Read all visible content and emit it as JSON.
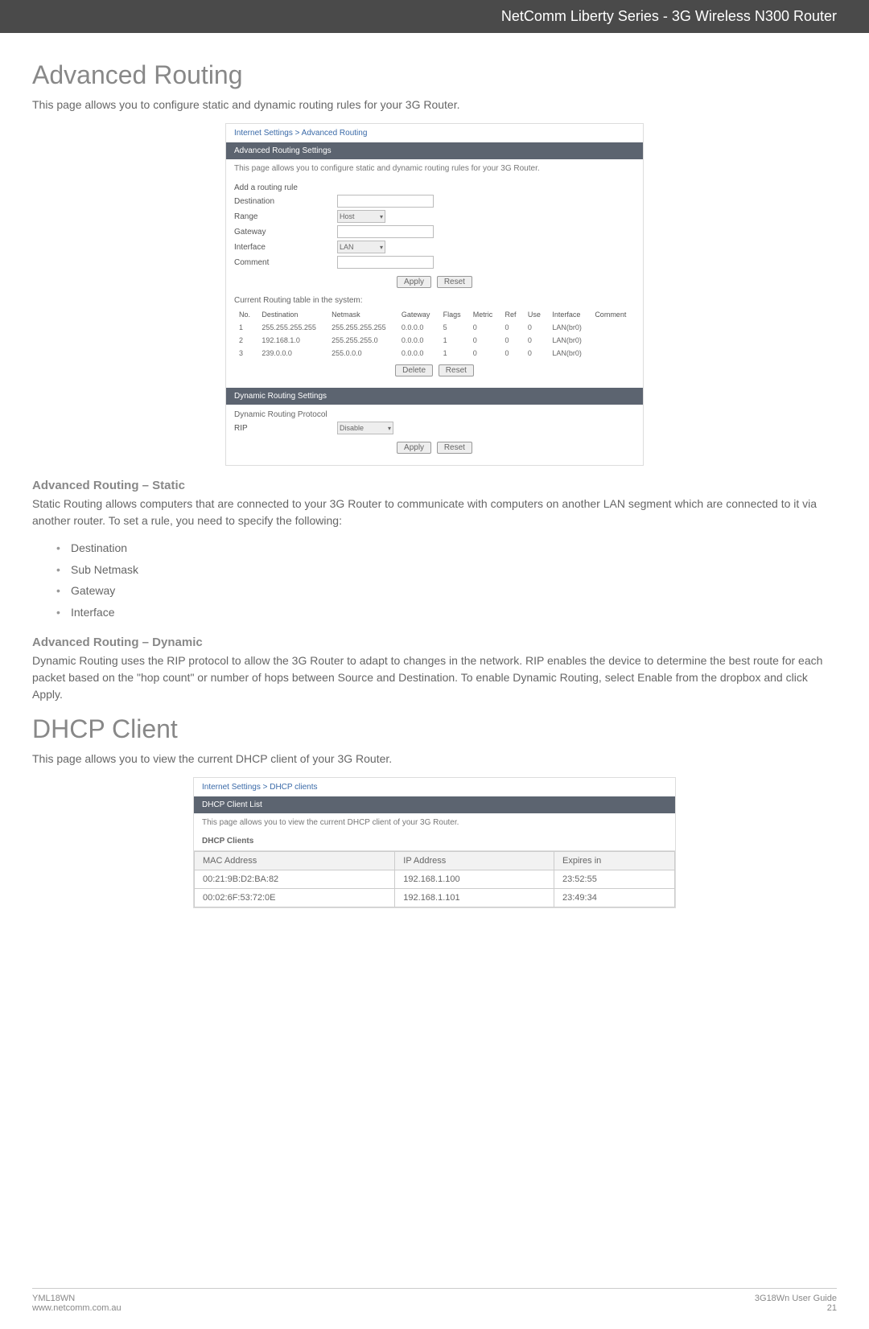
{
  "header": {
    "title": "NetComm Liberty Series - 3G Wireless N300 Router"
  },
  "adv_routing": {
    "title": "Advanced Routing",
    "intro": "This page allows you to configure static and dynamic routing rules for your 3G Router.",
    "static_title": "Advanced Routing – Static",
    "static_text_1": "Static Routing allows computers that are connected to your 3G Router to communicate with computers on another LAN segment which are connected to it via another router. To set a rule, you need to specify the following:",
    "bullets": [
      "Destination",
      "Sub Netmask",
      "Gateway",
      "Interface"
    ],
    "dynamic_title": "Advanced Routing – Dynamic",
    "dynamic_text": "Dynamic Routing uses the RIP protocol to allow the 3G Router to adapt to changes in the network. RIP enables the device to determine the best route for each packet based on the \"hop count\" or number of hops between Source and Destination. To enable Dynamic Routing, select Enable from the dropbox and click Apply."
  },
  "adv_fig": {
    "crumb": "Internet Settings > Advanced Routing",
    "band": "Advanced Routing Settings",
    "note": "This page allows you to configure static and dynamic routing rules for your 3G Router.",
    "add_rule": "Add a routing rule",
    "labels": {
      "dest": "Destination",
      "range": "Range",
      "gateway": "Gateway",
      "iface": "Interface",
      "comment": "Comment"
    },
    "range_val": "Host",
    "iface_val": "LAN",
    "btn_apply": "Apply",
    "btn_reset": "Reset",
    "table_title": "Current Routing table in the system:",
    "cols": [
      "No.",
      "Destination",
      "Netmask",
      "Gateway",
      "Flags",
      "Metric",
      "Ref",
      "Use",
      "Interface",
      "Comment"
    ],
    "rows": [
      [
        "1",
        "255.255.255.255",
        "255.255.255.255",
        "0.0.0.0",
        "5",
        "0",
        "0",
        "0",
        "LAN(br0)",
        ""
      ],
      [
        "2",
        "192.168.1.0",
        "255.255.255.0",
        "0.0.0.0",
        "1",
        "0",
        "0",
        "0",
        "LAN(br0)",
        ""
      ],
      [
        "3",
        "239.0.0.0",
        "255.0.0.0",
        "0.0.0.0",
        "1",
        "0",
        "0",
        "0",
        "LAN(br0)",
        ""
      ]
    ],
    "btn_delete": "Delete",
    "band2": "Dynamic Routing Settings",
    "drp_label": "Dynamic Routing Protocol",
    "rip_label": "RIP",
    "rip_val": "Disable"
  },
  "dhcp": {
    "title": "DHCP Client",
    "intro": "This page allows you to view the current DHCP client of your 3G Router."
  },
  "dhcp_fig": {
    "crumb": "Internet Settings > DHCP clients",
    "band": "DHCP Client List",
    "note": "This page allows you to view the current DHCP client of your 3G Router.",
    "sec": "DHCP Clients",
    "cols": [
      "MAC Address",
      "IP Address",
      "Expires in"
    ],
    "rows": [
      [
        "00:21:9B:D2:BA:82",
        "192.168.1.100",
        "23:52:55"
      ],
      [
        "00:02:6F:53:72:0E",
        "192.168.1.101",
        "23:49:34"
      ]
    ]
  },
  "footer": {
    "left1": "YML18WN",
    "left2": "www.netcomm.com.au",
    "right1": "3G18Wn User Guide",
    "right2": "21"
  }
}
